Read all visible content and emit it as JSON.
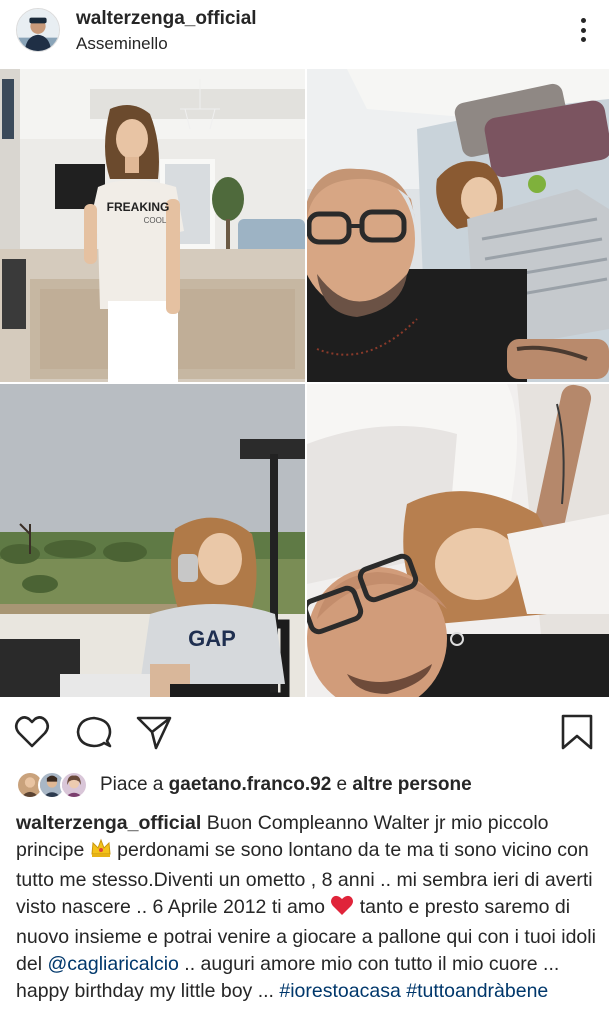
{
  "post": {
    "username": "walterzenga_official",
    "location": "Asseminello"
  },
  "likes": {
    "prefix": "Piace a ",
    "user": "gaetano.franco.92",
    "middle": " e ",
    "others": "altre persone"
  },
  "caption": {
    "author": "walterzenga_official",
    "part1": " Buon Compleanno Walter jr mio piccolo principe ",
    "part2": " perdonami se sono lontano da te ma ti sono vicino con tutto me stesso.Diventi un ometto , 8 anni .. mi sembra ieri di averti visto nascere .. 6 Aprile 2012 ti amo ",
    "part3": " tanto e presto saremo di nuovo insieme e potrai venire a giocare a pallone qui con i tuoi idoli del ",
    "mention": "@cagliaricalcio",
    "part4": " .. auguri amore mio con tutto il mio cuore ... happy birthday my little boy ... ",
    "hashtag1": "#iorestoacasa",
    "hashtag2": "#tuttoandràbene"
  },
  "photos": {
    "shirt_text": "FREAKING",
    "shirt_subtext": "COOL",
    "sweater_text": "GAP"
  },
  "colors": {
    "text": "#262626",
    "link": "#00376b",
    "heart": "#ed4956",
    "border": "#dbdbdb"
  },
  "icons": [
    "heart-outline-icon",
    "comment-icon",
    "share-icon",
    "bookmark-icon",
    "more-options-icon",
    "crown-emoji-icon",
    "red-heart-emoji-icon"
  ]
}
